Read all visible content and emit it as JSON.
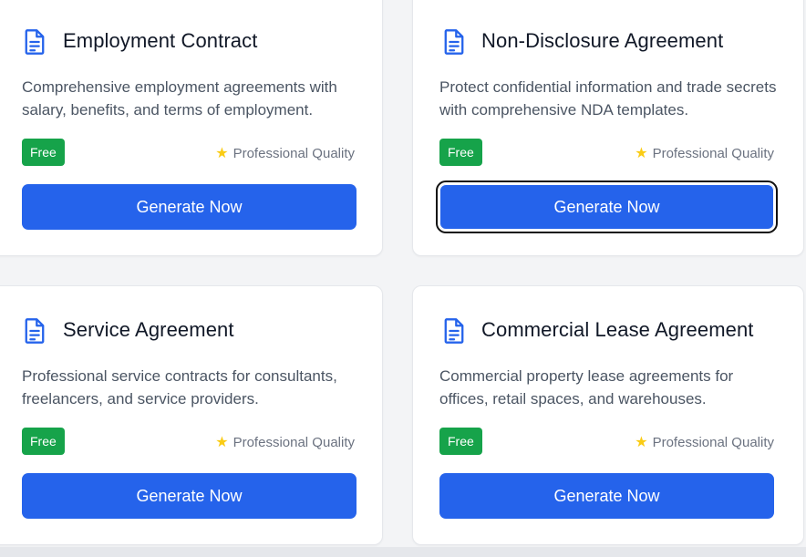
{
  "colors": {
    "accent": "#2563eb",
    "badge": "#16a34a",
    "star": "#facc15"
  },
  "cards": [
    {
      "title": "Employment Contract",
      "description": "Comprehensive employment agreements with salary, benefits, and terms of employment.",
      "badge": "Free",
      "quality": "Professional Quality",
      "button": "Generate Now",
      "icon": "document-icon"
    },
    {
      "title": "Non-Disclosure Agreement",
      "description": "Protect confidential information and trade secrets with comprehensive NDA templates.",
      "badge": "Free",
      "quality": "Professional Quality",
      "button": "Generate Now",
      "icon": "document-icon"
    },
    {
      "title": "Service Agreement",
      "description": "Professional service contracts for consultants, freelancers, and service providers.",
      "badge": "Free",
      "quality": "Professional Quality",
      "button": "Generate Now",
      "icon": "document-icon"
    },
    {
      "title": "Commercial Lease Agreement",
      "description": "Commercial property lease agreements for offices, retail spaces, and warehouses.",
      "badge": "Free",
      "quality": "Professional Quality",
      "button": "Generate Now",
      "icon": "document-icon"
    }
  ]
}
